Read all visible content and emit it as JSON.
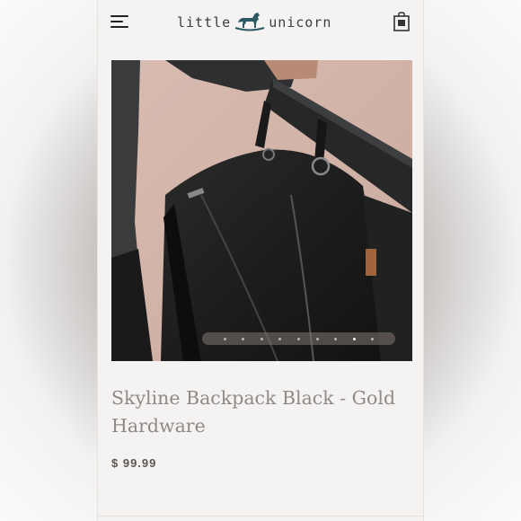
{
  "header": {
    "brand_left": "little",
    "brand_right": "unicorn",
    "brand_color": "#2b5a64",
    "menu_icon": "hamburger-icon",
    "cart_icon": "shopping-bag-icon"
  },
  "product": {
    "title": "Skyline Backpack Black - Gold Hardware",
    "price": "$ 99.99",
    "image_description_icon": "product-photo-backpack"
  },
  "carousel": {
    "total_slides": 9,
    "active_index": 7
  }
}
